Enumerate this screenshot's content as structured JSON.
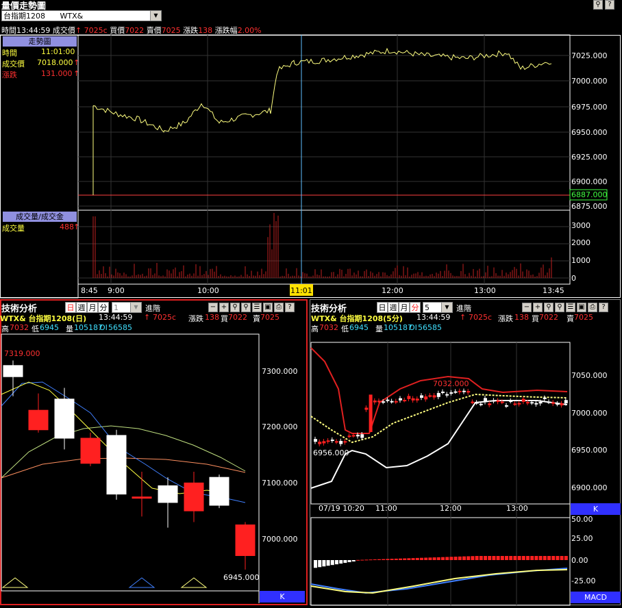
{
  "window": {
    "title": "量價走勢圖"
  },
  "symbol_select": {
    "value": "台指期1208",
    "code": "WTX&"
  },
  "quote_bar": {
    "time_label": "時間",
    "time": "13:44:59",
    "last_label": "成交價",
    "last": "7025",
    "last_suffix": "c",
    "bid_label": "買價",
    "bid": "7022",
    "ask_label": "賣價",
    "ask": "7025",
    "change_label": "漲跌",
    "change": "138",
    "pct_label": "漲跌幅",
    "pct": "2.00%"
  },
  "trend": {
    "panel_title": "走勢圖",
    "time_label": "時間",
    "time": "11:01:00",
    "price_label": "成交價",
    "price": "7018.000",
    "change_label": "漲跌",
    "change": "131.000",
    "price_axis": [
      "7025.000",
      "7000.000",
      "6975.000",
      "6950.000",
      "6925.000",
      "6900.000",
      "6875.000"
    ],
    "ref_price": "6887.000",
    "volume_title": "成交量/成交金",
    "volume_label": "成交量",
    "volume": "488",
    "volume_axis": [
      "3000",
      "2000",
      "1000",
      "0"
    ],
    "time_axis": [
      "8:45",
      "9:00",
      "10:00",
      "11:01",
      "12:00",
      "13:00",
      "13:45"
    ]
  },
  "tech_left": {
    "title": "技術分析",
    "period_buttons": [
      "日",
      "週",
      "月",
      "分"
    ],
    "period_value": "1",
    "advanced": "進階",
    "header": "WTX&  台指期1208(日)",
    "time": "13:44:59",
    "last": "7025c",
    "change_label": "漲跌",
    "change": "138",
    "bid_label": "買",
    "bid": "7022",
    "ask_label": "賣",
    "ask": "7025",
    "high_label": "高",
    "high": "7032",
    "low_label": "低",
    "low": "6945",
    "vol_label": "量",
    "vol": "105187",
    "oi_label": "OI",
    "oi": "56585",
    "max_label": "7319.000",
    "min_label": "6945.000",
    "price_axis": [
      "7300.000",
      "7200.000",
      "7100.000",
      "7000.000"
    ],
    "k_label": "K"
  },
  "tech_right": {
    "title": "技術分析",
    "period_buttons": [
      "日",
      "週",
      "月",
      "分"
    ],
    "period_value": "5",
    "advanced": "進階",
    "header": "WTX&  台指期1208(5分)",
    "time": "13:44:59",
    "last": "7025c",
    "change_label": "漲跌",
    "change": "138",
    "bid_label": "買",
    "bid": "7022",
    "ask_label": "賣",
    "ask": "7025",
    "high_label": "高",
    "high": "7032",
    "low_label": "低",
    "low": "6945",
    "vol_label": "量",
    "vol": "105187",
    "oi_label": "OI",
    "oi": "56585",
    "max_label": "7032.000",
    "min_label": "6956.000",
    "price_axis": [
      "7050.000",
      "7000.000",
      "6950.000",
      "6900.000"
    ],
    "time_axis": [
      "07/19 10:20",
      "11:00",
      "12:00",
      "13:00"
    ],
    "k_label": "K",
    "macd_axis": [
      "50.00",
      "25.00",
      "0.00",
      "-25.00"
    ],
    "macd_label": "MACD"
  },
  "colors": {
    "up": "#ff2020",
    "down": "#ffffff",
    "price_line": "#ffff80",
    "accent": "#3030ff"
  }
}
